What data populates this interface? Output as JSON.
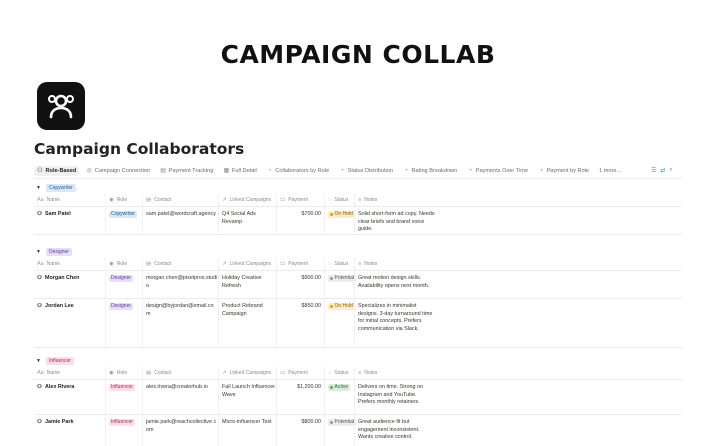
{
  "banner": "CAMPAIGN COLLAB",
  "page_title": "Campaign Collaborators",
  "tabs": [
    {
      "label": "Role-Based",
      "icon": "people-icon",
      "active": true
    },
    {
      "label": "Campaign Connection",
      "icon": "globe-icon"
    },
    {
      "label": "Payment Tracking",
      "icon": "table-icon"
    },
    {
      "label": "Full Detail",
      "icon": "grid-icon"
    },
    {
      "label": "Collaborators by Role",
      "icon": "chart-icon"
    },
    {
      "label": "Status Distribution",
      "icon": "chart-icon"
    },
    {
      "label": "Rating Breakdown",
      "icon": "chart-icon"
    },
    {
      "label": "Payments Over Time",
      "icon": "chart-icon"
    },
    {
      "label": "Payment by Role",
      "icon": "chart-icon"
    },
    {
      "label": "1 more...",
      "icon": ""
    }
  ],
  "columns": {
    "name": "Name",
    "role": "Role",
    "contact": "Contact",
    "campaigns": "Linked Campaigns",
    "payment": "Payment",
    "status": "Status",
    "notes": "Notes"
  },
  "colors": {
    "Copywriter": {
      "bg": "#d9e7f7",
      "fg": "#1f5a96"
    },
    "Designer": {
      "bg": "#e6def6",
      "fg": "#5b3a96"
    },
    "Influencer": {
      "bg": "#f9dfe5",
      "fg": "#9c2f4a"
    },
    "On Hold": {
      "bg": "#fbeccd",
      "fg": "#8a5a00",
      "dot": "#e0a100"
    },
    "Potential": {
      "bg": "#ececea",
      "fg": "#555",
      "dot": "#9b9a97"
    },
    "Active": {
      "bg": "#dbeddb",
      "fg": "#2b6c3a",
      "dot": "#4caf6a"
    }
  },
  "groups": [
    {
      "label": "Copywriter",
      "rows": [
        {
          "name": "Sam Patel",
          "role": "Copywriter",
          "contact": "sam.patel@wordcraft.agency",
          "campaigns": "Q4 Social Ads Revamp",
          "payment": "$700.00",
          "status": "On Hold",
          "notes": "Solid short-form ad copy. Needs clear briefs and brand voice guide."
        }
      ]
    },
    {
      "label": "Designer",
      "rows": [
        {
          "name": "Morgan Chen",
          "role": "Designer",
          "contact": "morgan.chen@pixelpros.studio",
          "campaigns": "Holiday Creative Refresh",
          "payment": "$900.00",
          "status": "Potential",
          "notes": "Great motion design skills. Availability opens next month."
        },
        {
          "name": "Jordan Lee",
          "role": "Designer",
          "contact": "design@byjordan@email.com",
          "campaigns": "Product Rebrand Campaign",
          "payment": "$850.00",
          "status": "On Hold",
          "notes": "Specializes in minimalist designs. 3-day turnaround time for initial concepts. Prefers communication via Slack."
        }
      ]
    },
    {
      "label": "Influencer",
      "rows": [
        {
          "name": "Alex Rivera",
          "role": "Influencer",
          "contact": "alex.rivera@creatorhub.io",
          "campaigns": "Fall Launch Influencer Wave",
          "payment": "$1,200.00",
          "status": "Active",
          "notes": "Delivers on time. Strong on Instagram and YouTube. Prefers monthly retainers."
        },
        {
          "name": "Jamie Park",
          "role": "Influencer",
          "contact": "jamie.park@reachcollective.com",
          "campaigns": "Micro-influencer Test",
          "payment": "$800.00",
          "status": "Potential",
          "notes": "Great audience fit but engagement inconsistent. Wants creative control."
        }
      ]
    }
  ]
}
